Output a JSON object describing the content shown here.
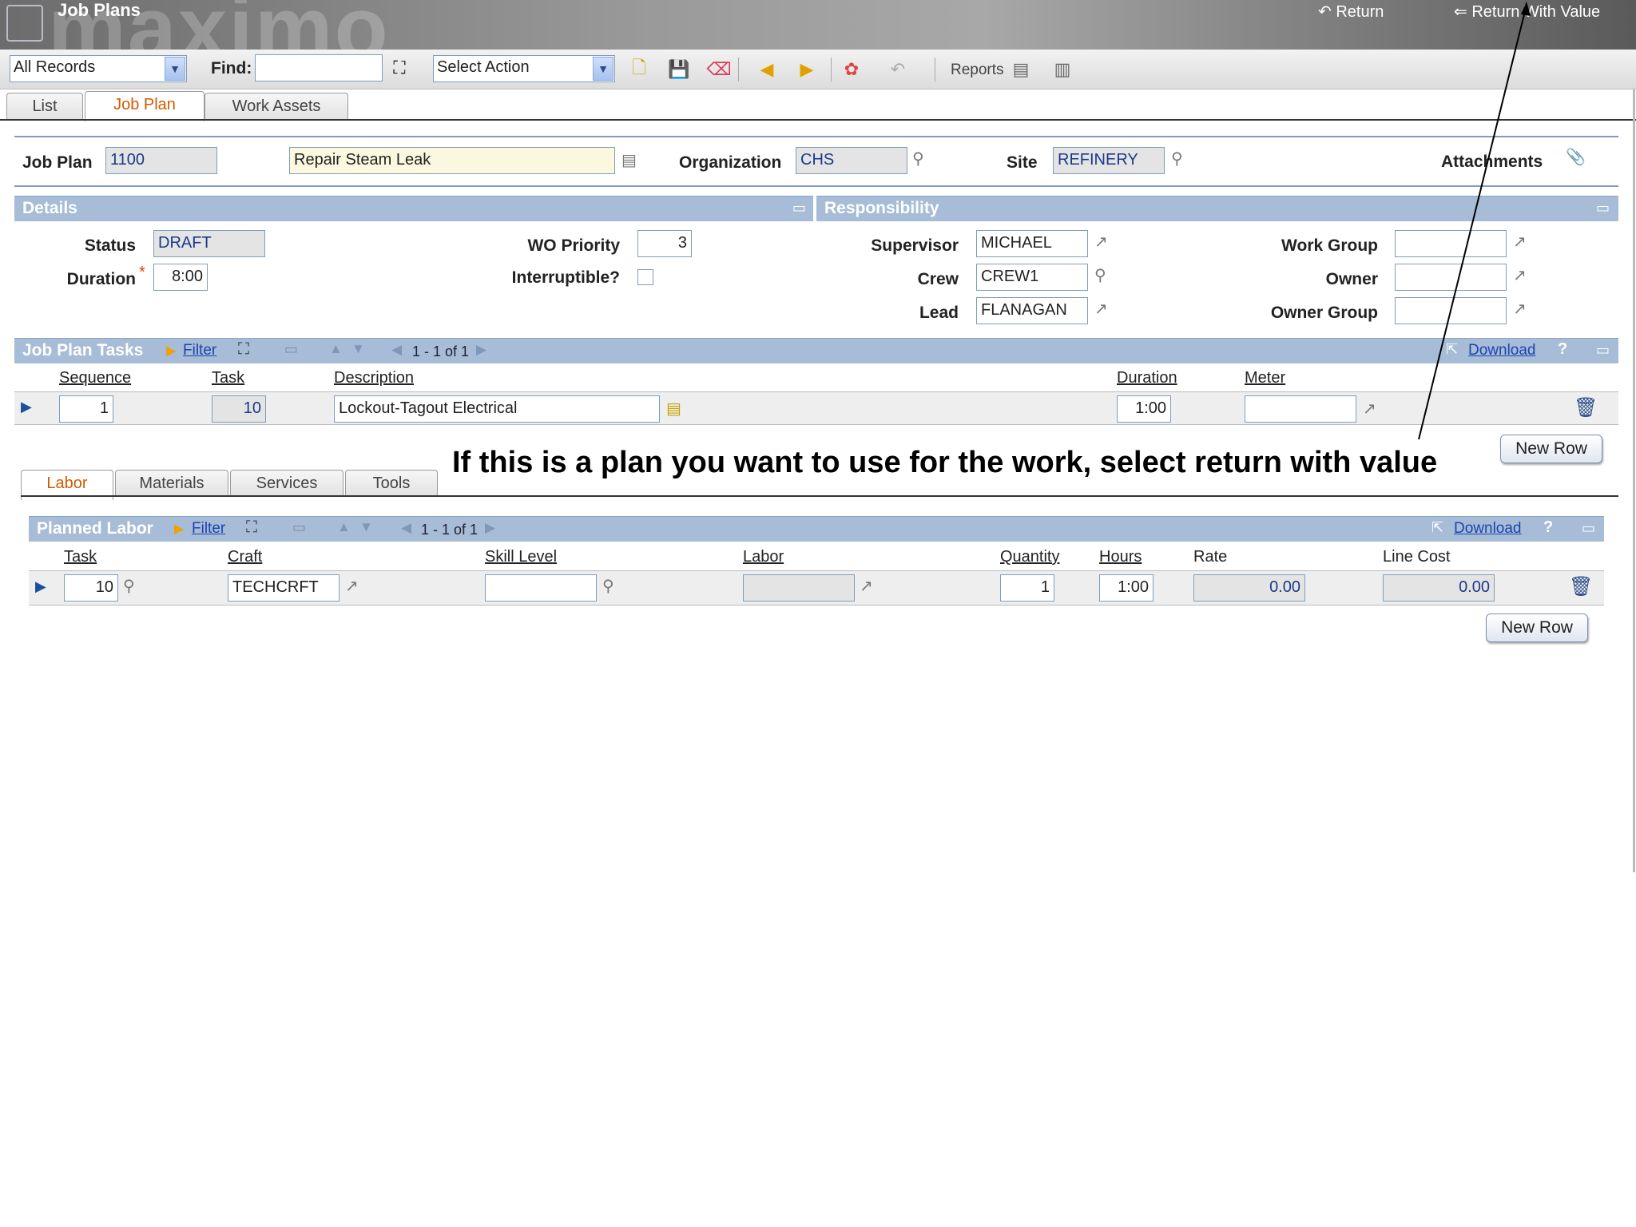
{
  "header": {
    "watermark": "maximo",
    "title": "Job Plans",
    "return_label": "Return",
    "return_value_label": "Return With Value"
  },
  "toolbar": {
    "records_select": "All Records",
    "find_label": "Find:",
    "find_value": "",
    "action_select": "Select Action",
    "reports_label": "Reports"
  },
  "tabs": [
    "List",
    "Job Plan",
    "Work Assets"
  ],
  "jobplan": {
    "jobplan_label": "Job Plan",
    "jobplan_value": "1100",
    "description": "Repair Steam Leak",
    "organization_label": "Organization",
    "organization_value": "CHS",
    "site_label": "Site",
    "site_value": "REFINERY",
    "attachments_label": "Attachments"
  },
  "details": {
    "section_title": "Details",
    "status_label": "Status",
    "status_value": "DRAFT",
    "duration_label": "Duration",
    "required_mark": "*",
    "duration_value": "8:00",
    "wo_priority_label": "WO Priority",
    "wo_priority_value": "3",
    "interruptible_label": "Interruptible?"
  },
  "responsibility": {
    "section_title": "Responsibility",
    "supervisor_label": "Supervisor",
    "supervisor_value": "MICHAEL",
    "crew_label": "Crew",
    "crew_value": "CREW1",
    "lead_label": "Lead",
    "lead_value": "FLANAGAN",
    "work_group_label": "Work Group",
    "work_group_value": "",
    "owner_label": "Owner",
    "owner_value": "",
    "owner_group_label": "Owner Group",
    "owner_group_value": ""
  },
  "tasks": {
    "title": "Job Plan Tasks",
    "filter_label": "Filter",
    "pager": "1 - 1 of 1",
    "download_label": "Download",
    "help_label": "?",
    "columns": [
      "Sequence",
      "Task",
      "Description",
      "Duration",
      "Meter"
    ],
    "row": {
      "sequence": "1",
      "task": "10",
      "description": "Lockout-Tagout Electrical",
      "duration": "1:00",
      "meter": ""
    },
    "new_row_label": "New Row"
  },
  "annotation": "If this is a plan you want to use for the work, select return with value",
  "subtabs": [
    "Labor",
    "Materials",
    "Services",
    "Tools"
  ],
  "labor": {
    "title": "Planned Labor",
    "filter_label": "Filter",
    "pager": "1 - 1 of 1",
    "download_label": "Download",
    "help_label": "?",
    "columns": [
      "Task",
      "Craft",
      "Skill Level",
      "Labor",
      "Quantity",
      "Hours",
      "Rate",
      "Line Cost"
    ],
    "row": {
      "task": "10",
      "craft": "TECHCRFT",
      "skill_level": "",
      "labor": "",
      "quantity": "1",
      "hours": "1:00",
      "rate": "0.00",
      "line_cost": "0.00"
    },
    "new_row_label": "New Row"
  }
}
